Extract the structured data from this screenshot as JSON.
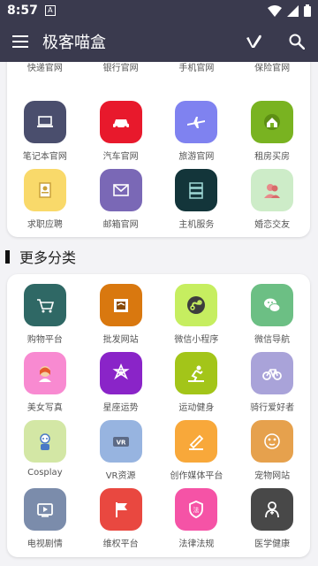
{
  "status_bar": {
    "time": "8:57",
    "notif_letter": "A"
  },
  "app_bar": {
    "title": "极客喵盒"
  },
  "sections": {
    "top": {
      "partial_labels": [
        "快递官网",
        "银行官网",
        "手机官网",
        "保险官网"
      ],
      "items": [
        {
          "label": "笔记本官网",
          "color": "#4a4e6d",
          "icon": "laptop-icon"
        },
        {
          "label": "汽车官网",
          "color": "#e8192c",
          "icon": "car-icon"
        },
        {
          "label": "旅游官网",
          "color": "#7f82f0",
          "icon": "airplane-icon"
        },
        {
          "label": "租房买房",
          "color": "#79b321",
          "icon": "house-icon"
        },
        {
          "label": "求职应聘",
          "color": "#f9d96a",
          "icon": "resume-icon"
        },
        {
          "label": "邮箱官网",
          "color": "#7a68b6",
          "icon": "mail-icon"
        },
        {
          "label": "主机服务",
          "color": "#13353a",
          "icon": "server-icon"
        },
        {
          "label": "婚恋交友",
          "color": "#cdecc8",
          "icon": "couple-icon"
        }
      ]
    },
    "more": {
      "title": "更多分类",
      "items": [
        {
          "label": "购物平台",
          "color": "#2f6865",
          "icon": "cart-icon"
        },
        {
          "label": "批发网站",
          "color": "#d9780f",
          "icon": "wholesale-icon"
        },
        {
          "label": "微信小程序",
          "color": "#c6ee60",
          "icon": "mini-program-icon"
        },
        {
          "label": "微信导航",
          "color": "#6cbf84",
          "icon": "wechat-icon"
        },
        {
          "label": "美女写真",
          "color": "#f88ad1",
          "icon": "portrait-icon"
        },
        {
          "label": "星座运势",
          "color": "#8a24c8",
          "icon": "star-icon"
        },
        {
          "label": "运动健身",
          "color": "#a3c519",
          "icon": "fitness-icon"
        },
        {
          "label": "骑行爱好者",
          "color": "#a9a3d9",
          "icon": "bicycle-icon"
        },
        {
          "label": "Cosplay",
          "color": "#d3e7a5",
          "icon": "cosplay-icon"
        },
        {
          "label": "VR资源",
          "color": "#97b4e0",
          "icon": "vr-icon"
        },
        {
          "label": "创作媒体平台",
          "color": "#f8a83a",
          "icon": "pen-icon"
        },
        {
          "label": "宠物网站",
          "color": "#e6a14d",
          "icon": "pet-icon"
        },
        {
          "label": "电视剧情",
          "color": "#7b8cab",
          "icon": "tv-icon"
        },
        {
          "label": "维权平台",
          "color": "#e94840",
          "icon": "flag-icon"
        },
        {
          "label": "法律法规",
          "color": "#f553a6",
          "icon": "law-icon"
        },
        {
          "label": "医学健康",
          "color": "#484848",
          "icon": "doctor-icon"
        }
      ]
    }
  }
}
